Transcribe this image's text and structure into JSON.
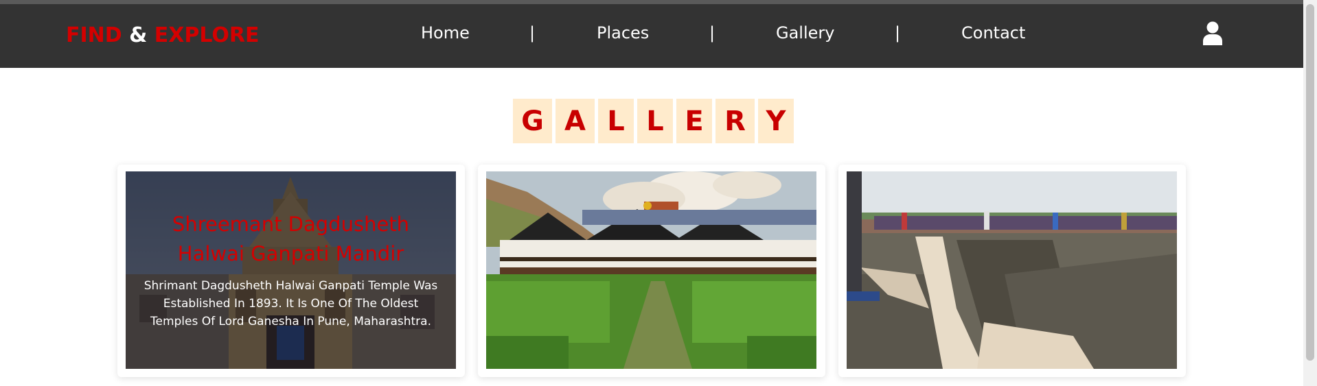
{
  "navbar": {
    "logo": {
      "part1": "FIND",
      "part2": "&",
      "part3": "EXPLORE"
    },
    "links": [
      "Home",
      "Places",
      "Gallery",
      "Contact"
    ],
    "separator": "|",
    "user_icon": "user-icon"
  },
  "gallery": {
    "heading_letters": [
      "G",
      "A",
      "L",
      "L",
      "E",
      "R",
      "Y"
    ],
    "cards": [
      {
        "image": "temple-photo",
        "title": "Shreemant Dagdusheth Halwai Ganpati Mandir",
        "description": "Shrimant Dagdusheth Halwai Ganpati Temple Was Established In 1893. It Is One Of The Oldest Temples Of Lord Ganesha In Pune, Maharashtra."
      },
      {
        "image": "vineyard-photo"
      },
      {
        "image": "waterfall-photo"
      }
    ]
  },
  "colors": {
    "navbar_bg": "#333333",
    "accent_red": "#d40000",
    "heading_tile_bg": "#ffebcc"
  }
}
